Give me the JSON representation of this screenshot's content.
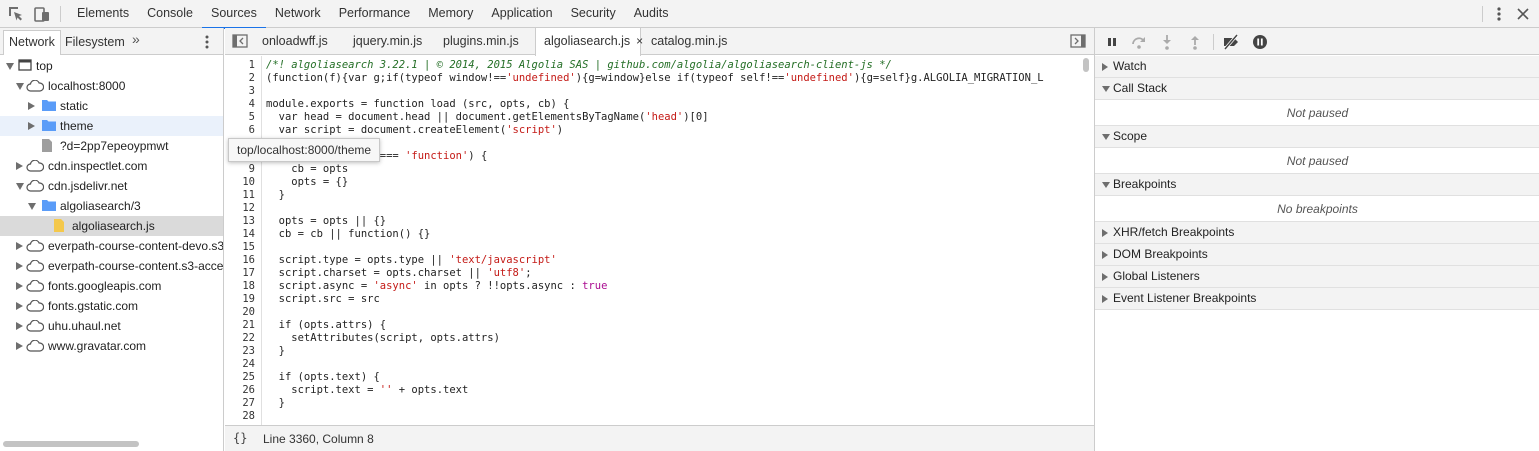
{
  "toolbar": {
    "tabs": [
      "Elements",
      "Console",
      "Sources",
      "Network",
      "Performance",
      "Memory",
      "Application",
      "Security",
      "Audits"
    ],
    "active_tab": "Sources",
    "accent_color": "#1a73e8"
  },
  "navigator": {
    "tabs": [
      "Network",
      "Filesystem"
    ],
    "active_tab": "Network",
    "more_tabs_glyph": "»",
    "tree": [
      {
        "label": "top",
        "depth": 0,
        "icon": "frame-icon",
        "expanded": true
      },
      {
        "label": "localhost:8000",
        "depth": 1,
        "icon": "cloud-icon",
        "expanded": true
      },
      {
        "label": "static",
        "depth": 2,
        "icon": "folder-icon",
        "expanded": false
      },
      {
        "label": "theme",
        "depth": 2,
        "icon": "folder-icon",
        "expanded": false,
        "hover": true
      },
      {
        "label": "?d=2pp7epeoypmwt",
        "depth": 2,
        "icon": "file-icon"
      },
      {
        "label": "cdn.inspectlet.com",
        "depth": 1,
        "icon": "cloud-icon",
        "expanded": false
      },
      {
        "label": "cdn.jsdelivr.net",
        "depth": 1,
        "icon": "cloud-icon",
        "expanded": true
      },
      {
        "label": "algoliasearch/3",
        "depth": 2,
        "icon": "folder-icon",
        "expanded": true
      },
      {
        "label": "algoliasearch.js",
        "depth": 3,
        "icon": "js-file-icon",
        "selected": true
      },
      {
        "label": "everpath-course-content-devo.s3",
        "depth": 1,
        "icon": "cloud-icon",
        "expanded": false
      },
      {
        "label": "everpath-course-content.s3-acce",
        "depth": 1,
        "icon": "cloud-icon",
        "expanded": false
      },
      {
        "label": "fonts.googleapis.com",
        "depth": 1,
        "icon": "cloud-icon",
        "expanded": false
      },
      {
        "label": "fonts.gstatic.com",
        "depth": 1,
        "icon": "cloud-icon",
        "expanded": false
      },
      {
        "label": "uhu.uhaul.net",
        "depth": 1,
        "icon": "cloud-icon",
        "expanded": false
      },
      {
        "label": "www.gravatar.com",
        "depth": 1,
        "icon": "cloud-icon",
        "expanded": false
      }
    ],
    "tooltip": "top/localhost:8000/theme"
  },
  "editor": {
    "tabs": [
      {
        "label": "onloadwff.js",
        "active": false
      },
      {
        "label": "jquery.min.js",
        "active": false
      },
      {
        "label": "plugins.min.js",
        "active": false
      },
      {
        "label": "algoliasearch.js",
        "active": true,
        "closable": true
      },
      {
        "label": "catalog.min.js",
        "active": false
      }
    ],
    "close_glyph": "×",
    "lines": [
      {
        "n": "1",
        "t": [
          [
            "c",
            "/*! algoliasearch 3.22.1 | © 2014, 2015 Algolia SAS | github.com/algolia/algoliasearch-client-js */"
          ]
        ]
      },
      {
        "n": "2",
        "t": [
          [
            "p",
            "(function(f){var g;if(typeof window!=="
          ],
          [
            "s",
            "'undefined'"
          ],
          [
            "p",
            "){g=window}else if(typeof self!=="
          ],
          [
            "s",
            "'undefined'"
          ],
          [
            "p",
            "){g=self}g.ALGOLIA_MIGRATION_L"
          ]
        ]
      },
      {
        "n": "3",
        "t": [
          [
            "p",
            ""
          ]
        ]
      },
      {
        "n": "4",
        "t": [
          [
            "p",
            "module.exports = function load (src, opts, cb) {"
          ]
        ]
      },
      {
        "n": "5",
        "t": [
          [
            "p",
            "  var head = document.head || document.getElementsByTagName("
          ],
          [
            "s",
            "'head'"
          ],
          [
            "p",
            ")[0]"
          ]
        ]
      },
      {
        "n": "6",
        "t": [
          [
            "p",
            "  var script = document.createElement("
          ],
          [
            "s",
            "'script'"
          ],
          [
            "p",
            ")"
          ]
        ]
      },
      {
        "n": "7",
        "t": [
          [
            "p",
            ""
          ]
        ]
      },
      {
        "n": "8",
        "t": [
          [
            "p",
            "  if (typeof opts === "
          ],
          [
            "s",
            "'function'"
          ],
          [
            "p",
            ") {"
          ]
        ]
      },
      {
        "n": "9",
        "t": [
          [
            "p",
            "    cb = opts"
          ]
        ]
      },
      {
        "n": "10",
        "t": [
          [
            "p",
            "    opts = {}"
          ]
        ]
      },
      {
        "n": "11",
        "t": [
          [
            "p",
            "  }"
          ]
        ]
      },
      {
        "n": "12",
        "t": [
          [
            "p",
            ""
          ]
        ]
      },
      {
        "n": "13",
        "t": [
          [
            "p",
            "  opts = opts || {}"
          ]
        ]
      },
      {
        "n": "14",
        "t": [
          [
            "p",
            "  cb = cb || function() {}"
          ]
        ]
      },
      {
        "n": "15",
        "t": [
          [
            "p",
            ""
          ]
        ]
      },
      {
        "n": "16",
        "t": [
          [
            "p",
            "  script.type = opts.type || "
          ],
          [
            "s",
            "'text/javascript'"
          ]
        ]
      },
      {
        "n": "17",
        "t": [
          [
            "p",
            "  script.charset = opts.charset || "
          ],
          [
            "s",
            "'utf8'"
          ],
          [
            "p",
            ";"
          ]
        ]
      },
      {
        "n": "18",
        "t": [
          [
            "p",
            "  script.async = "
          ],
          [
            "s",
            "'async'"
          ],
          [
            "p",
            " in opts ? !!opts.async : "
          ],
          [
            "k",
            "true"
          ]
        ]
      },
      {
        "n": "19",
        "t": [
          [
            "p",
            "  script.src = src"
          ]
        ]
      },
      {
        "n": "20",
        "t": [
          [
            "p",
            ""
          ]
        ]
      },
      {
        "n": "21",
        "t": [
          [
            "p",
            "  if (opts.attrs) {"
          ]
        ]
      },
      {
        "n": "22",
        "t": [
          [
            "p",
            "    setAttributes(script, opts.attrs)"
          ]
        ]
      },
      {
        "n": "23",
        "t": [
          [
            "p",
            "  }"
          ]
        ]
      },
      {
        "n": "24",
        "t": [
          [
            "p",
            ""
          ]
        ]
      },
      {
        "n": "25",
        "t": [
          [
            "p",
            "  if (opts.text) {"
          ]
        ]
      },
      {
        "n": "26",
        "t": [
          [
            "p",
            "    script.text = "
          ],
          [
            "s",
            "''"
          ],
          [
            "p",
            " + opts.text"
          ]
        ]
      },
      {
        "n": "27",
        "t": [
          [
            "p",
            "  }"
          ]
        ]
      },
      {
        "n": "28",
        "t": [
          [
            "p",
            ""
          ]
        ]
      }
    ],
    "status": {
      "pretty_print": "{}",
      "cursor": "Line 3360, Column 8"
    }
  },
  "debugger": {
    "panes": [
      {
        "title": "Watch",
        "expanded": false
      },
      {
        "title": "Call Stack",
        "expanded": true,
        "body": "Not paused"
      },
      {
        "title": "Scope",
        "expanded": true,
        "body": "Not paused"
      },
      {
        "title": "Breakpoints",
        "expanded": true,
        "body": "No breakpoints"
      },
      {
        "title": "XHR/fetch Breakpoints",
        "expanded": false
      },
      {
        "title": "DOM Breakpoints",
        "expanded": false
      },
      {
        "title": "Global Listeners",
        "expanded": false
      },
      {
        "title": "Event Listener Breakpoints",
        "expanded": false
      }
    ]
  },
  "colors": {
    "string": "#c41a16",
    "comment": "#236e25",
    "keyword": "#aa0d91",
    "folder": "#5a9cf8",
    "js_file": "#f4c84b"
  }
}
